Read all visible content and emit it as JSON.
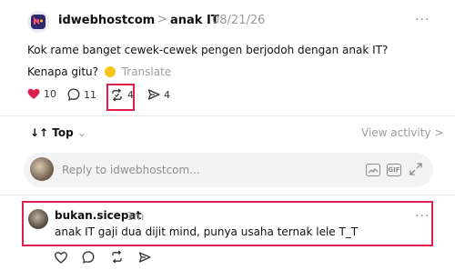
{
  "post": {
    "author": "idwebhostcom",
    "separator": ">",
    "community": "anak IT",
    "date": "08/21/26",
    "more": "···",
    "line1": "Kok rame banget cewek-cewek pengen berjodoh dengan anak IT?",
    "line2_prefix": "Kenapa gitu?",
    "translate": "Translate",
    "actions": {
      "likes": "10",
      "comments": "11",
      "reposts": "4",
      "shares": "4"
    }
  },
  "sort": {
    "label": "Top",
    "view_activity": "View activity >"
  },
  "reply_bar": {
    "placeholder": "Reply to idwebhostcom..."
  },
  "reply": {
    "username": "bukan.sicepat",
    "time": "1m",
    "more": "···",
    "text": "anak IT gaji dua dijit mind, punya usaha ternak lele T_T"
  },
  "colors": {
    "highlight": "#e0204c",
    "like": "#e0204c"
  }
}
